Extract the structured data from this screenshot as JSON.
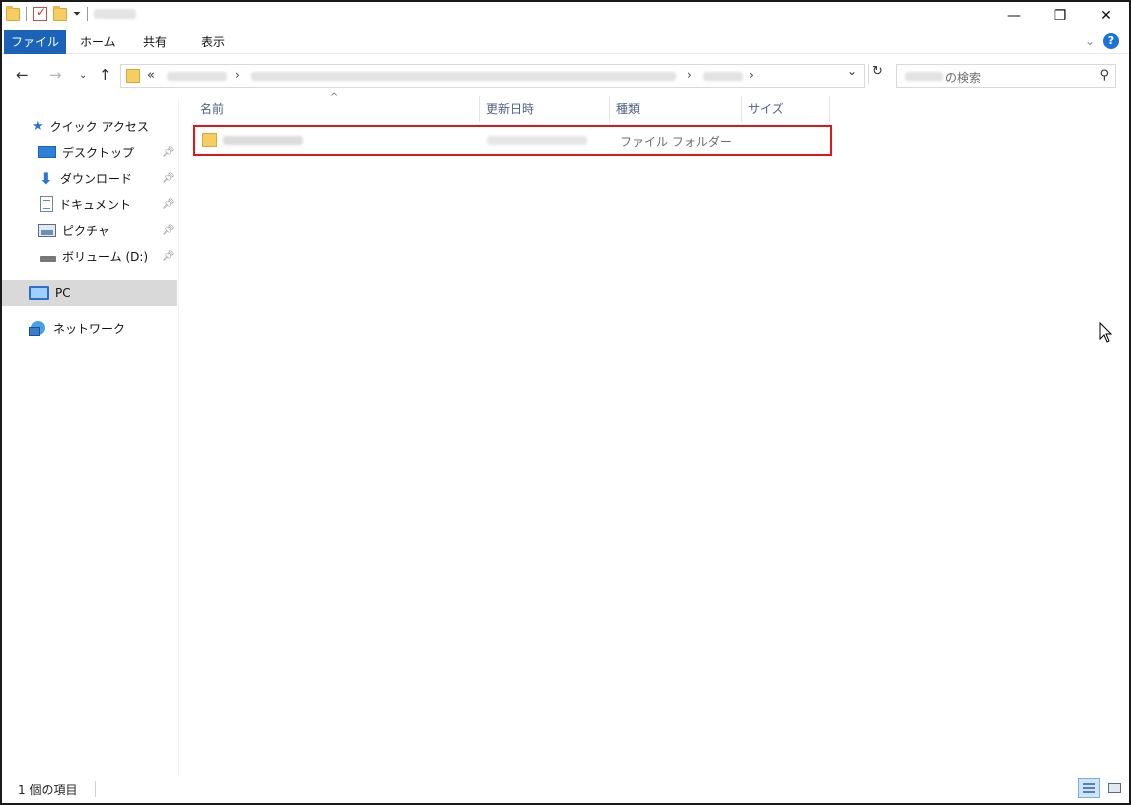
{
  "ribbon": {
    "file_tab": "ファイル",
    "home_tab": "ホーム",
    "share_tab": "共有",
    "view_tab": "表示"
  },
  "address": {
    "overflow": "«",
    "sep": "›"
  },
  "search": {
    "placeholder": "の検索"
  },
  "nav": {
    "quick_access": "クイック アクセス",
    "desktop": "デスクトップ",
    "downloads": "ダウンロード",
    "documents": "ドキュメント",
    "pictures": "ピクチャ",
    "volume": "ボリューム (D:)",
    "pc": "PC",
    "network": "ネットワーク"
  },
  "columns": {
    "name": "名前",
    "modified": "更新日時",
    "type": "種類",
    "size": "サイズ"
  },
  "files": [
    {
      "type": "ファイル フォルダー"
    }
  ],
  "status": {
    "item_count": "1 個の項目"
  },
  "icons": {
    "pin": "pin-icon",
    "folder": "folder-icon",
    "help": "help-icon"
  },
  "colors": {
    "accent": "#1a63b8",
    "highlight": "#e0161b",
    "selected_nav": "#d9d9d9"
  }
}
